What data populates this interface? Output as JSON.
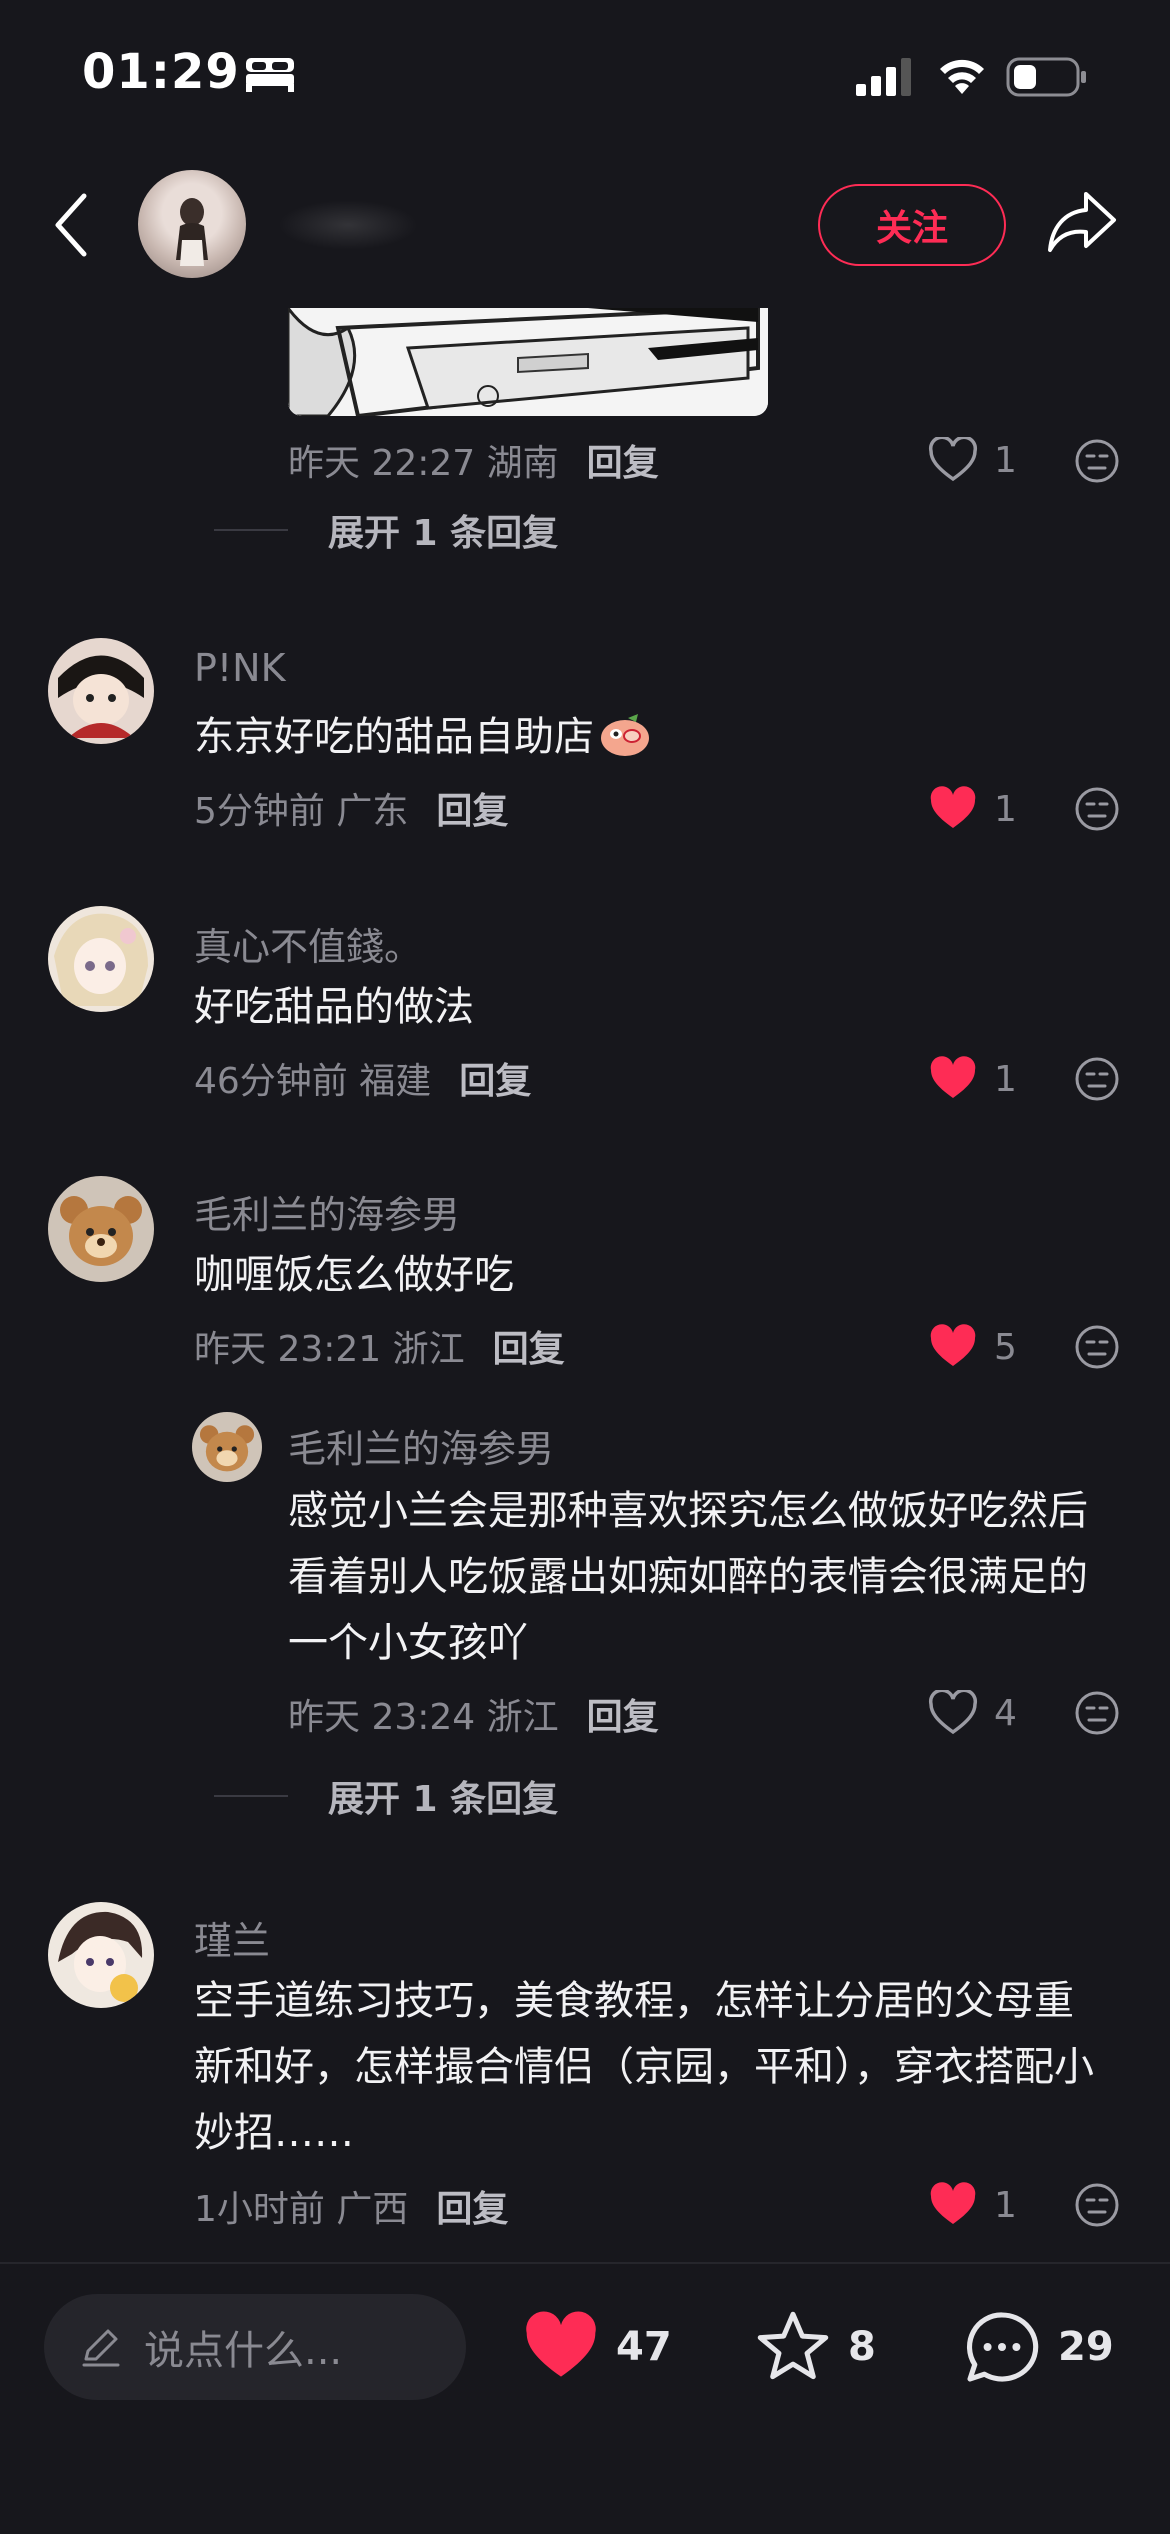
{
  "status_bar": {
    "time": "01:29"
  },
  "header": {
    "follow_label": "关注"
  },
  "colors": {
    "accent": "#fe2c55",
    "background": "#17171c",
    "muted_text": "#8a8a92"
  },
  "top_comment": {
    "time_location": "昨天 22:27 湖南",
    "reply_label": "回复",
    "like_count": "1",
    "liked": false,
    "expand_label": "展开 1 条回复"
  },
  "comments": [
    {
      "user": "P!NK",
      "text": "东京好吃的甜品自助店",
      "emoji_icon": "candy-face-emoji",
      "time_location": "5分钟前 广东",
      "reply_label": "回复",
      "like_count": "1",
      "liked": true
    },
    {
      "user": "真心不值錢。",
      "text": "好吃甜品的做法",
      "time_location": "46分钟前 福建",
      "reply_label": "回复",
      "like_count": "1",
      "liked": true
    },
    {
      "user": "毛利兰的海参男",
      "text": "咖喱饭怎么做好吃",
      "time_location": "昨天 23:21 浙江",
      "reply_label": "回复",
      "like_count": "5",
      "liked": true
    },
    {
      "user": "瑾兰",
      "text_lines": [
        "空手道练习技巧，美食教程，怎样让分居的父母重",
        "新和好，怎样撮合情侣（京园，平和），穿衣搭配小",
        "妙招……"
      ],
      "time_location": "1小时前 广西",
      "reply_label": "回复",
      "like_count": "1",
      "liked": true
    }
  ],
  "reply": {
    "user": "毛利兰的海参男",
    "text_lines": [
      "感觉小兰会是那种喜欢探究怎么做饭好吃然后",
      "看着别人吃饭露出如痴如醉的表情会很满足的",
      "一个小女孩吖"
    ],
    "time_location": "昨天 23:24 浙江",
    "reply_label": "回复",
    "like_count": "4",
    "liked": false,
    "expand_label": "展开 1 条回复"
  },
  "bottom_bar": {
    "input_placeholder": "说点什么...",
    "like_count": "47",
    "favorite_count": "8",
    "comment_count": "29"
  }
}
